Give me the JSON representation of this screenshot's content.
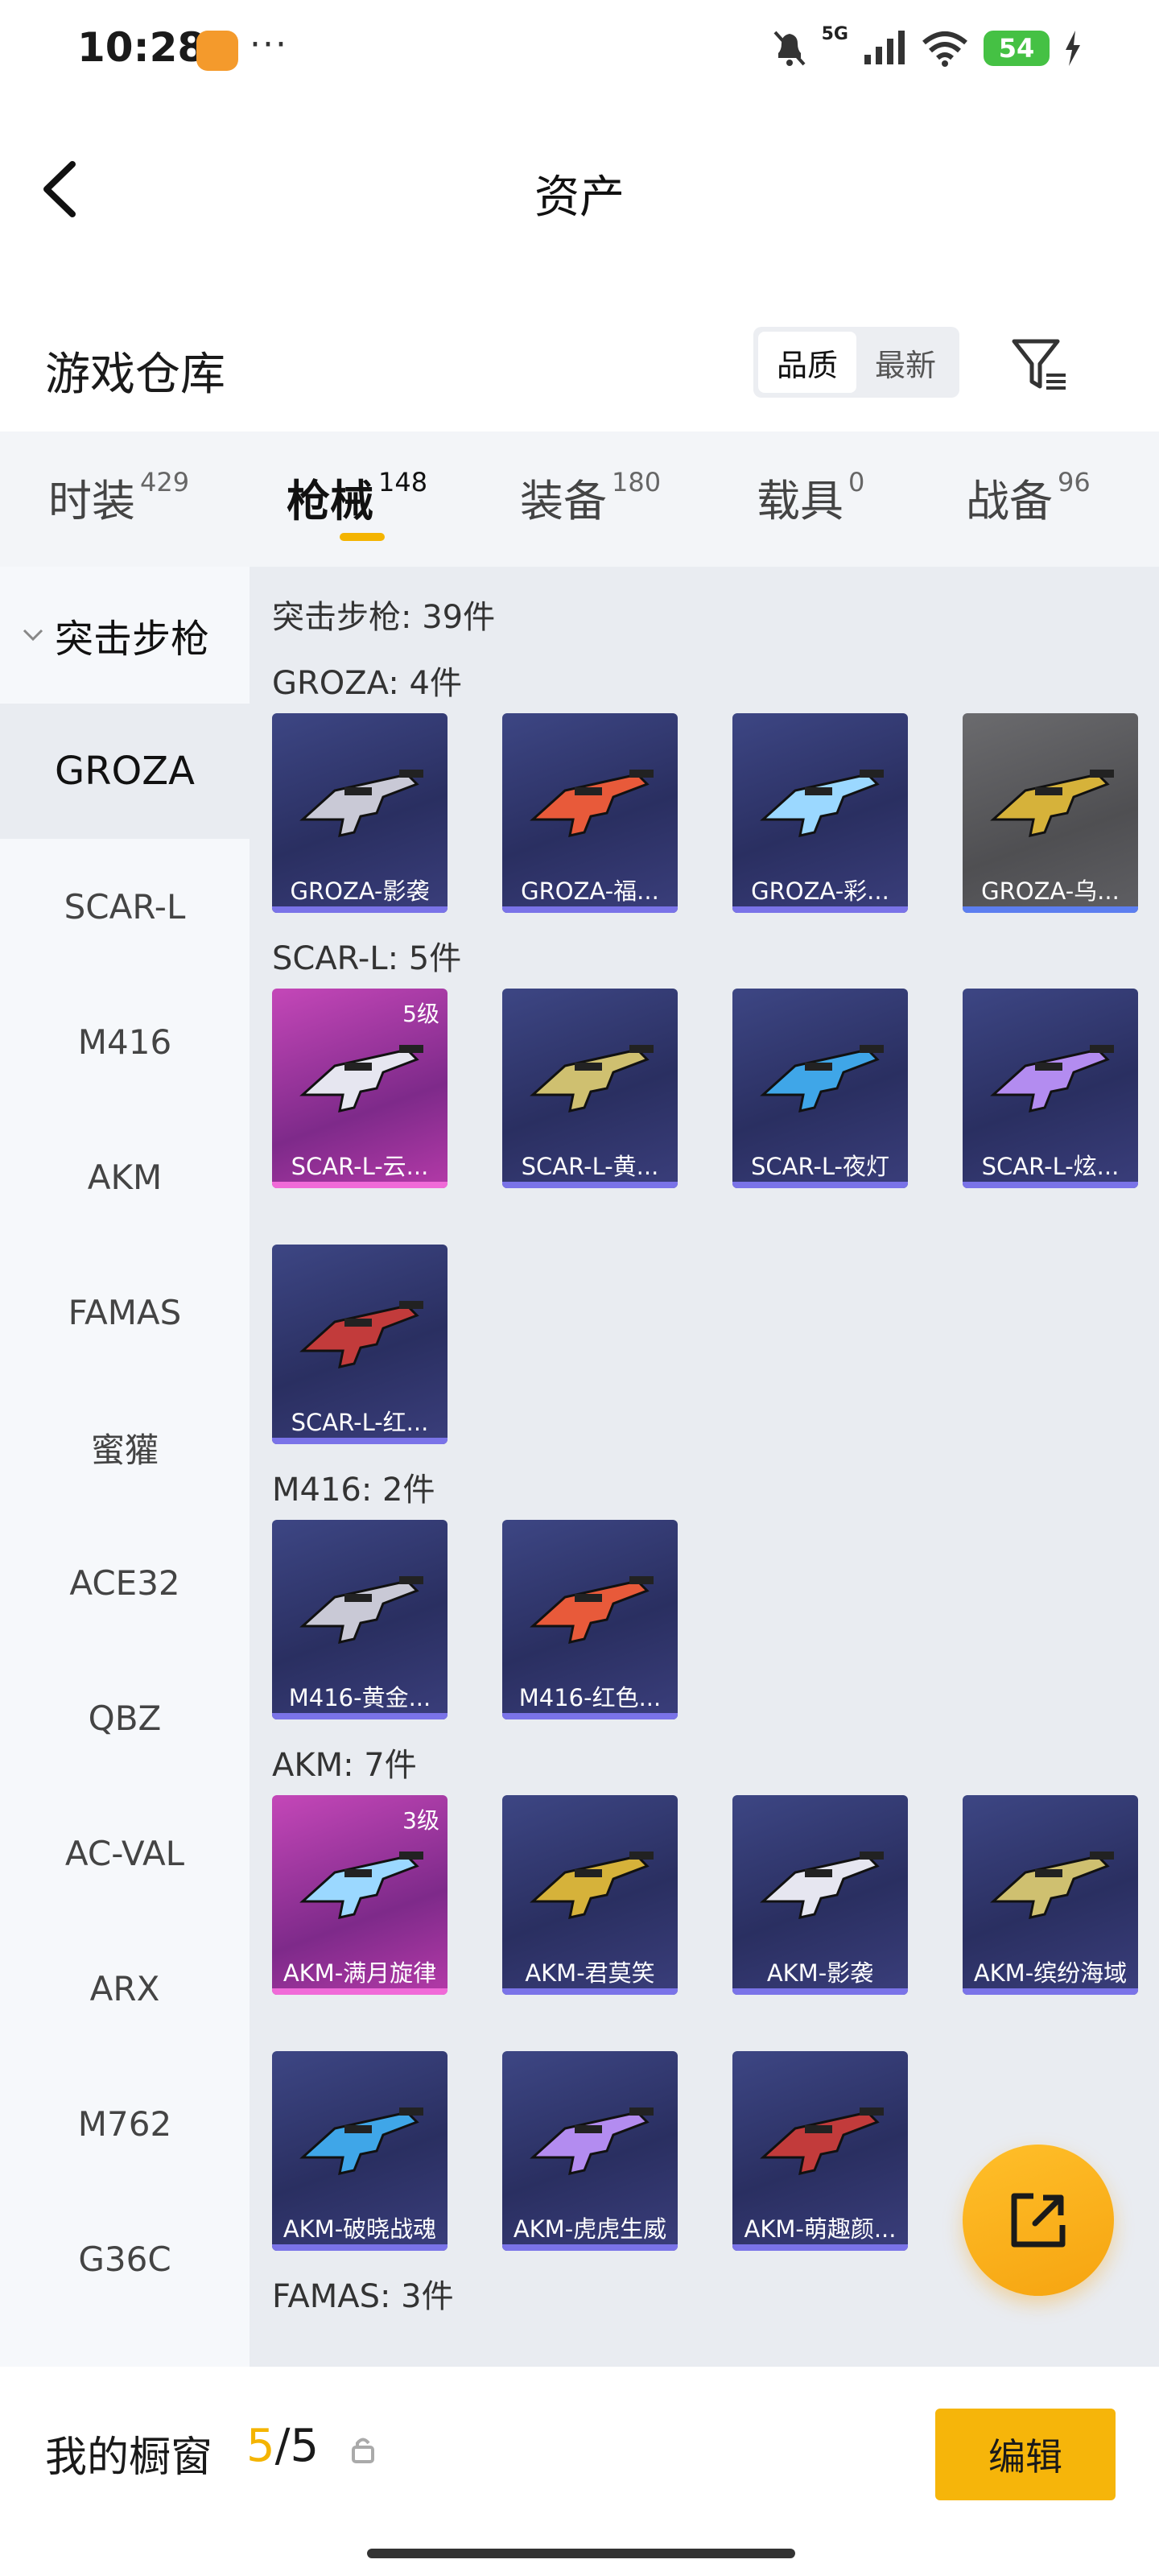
{
  "status_bar": {
    "time": "10:28",
    "more": "···",
    "signal_label": "5G",
    "battery": "54"
  },
  "nav": {
    "title": "资产"
  },
  "header": {
    "title": "游戏仓库",
    "sort_options": [
      "品质",
      "最新"
    ],
    "active_sort": "品质"
  },
  "tabs": [
    {
      "label": "时装",
      "count": "429"
    },
    {
      "label": "枪械",
      "count": "148"
    },
    {
      "label": "装备",
      "count": "180"
    },
    {
      "label": "载具",
      "count": "0"
    },
    {
      "label": "战备",
      "count": "96"
    }
  ],
  "active_tab": "枪械",
  "sidebar": {
    "category": "突击步枪",
    "items": [
      "GROZA",
      "SCAR-L",
      "M416",
      "AKM",
      "FAMAS",
      "蜜獾",
      "ACE32",
      "QBZ",
      "AC-VAL",
      "ARX",
      "M762",
      "G36C"
    ],
    "active_item": "GROZA"
  },
  "main": {
    "summary": "突击步枪: 39件",
    "groups": [
      {
        "title": "GROZA: 4件",
        "items": [
          {
            "name": "GROZA-影袭",
            "tier": "purple",
            "level": ""
          },
          {
            "name": "GROZA-福...",
            "tier": "purple",
            "level": ""
          },
          {
            "name": "GROZA-彩...",
            "tier": "purple",
            "level": ""
          },
          {
            "name": "GROZA-乌...",
            "tier": "gray",
            "level": ""
          }
        ]
      },
      {
        "title": "SCAR-L: 5件",
        "items": [
          {
            "name": "SCAR-L-云...",
            "tier": "pink",
            "level": "5级"
          },
          {
            "name": "SCAR-L-黄...",
            "tier": "purple",
            "level": ""
          },
          {
            "name": "SCAR-L-夜灯",
            "tier": "purple",
            "level": ""
          },
          {
            "name": "SCAR-L-炫...",
            "tier": "purple",
            "level": ""
          },
          {
            "name": "SCAR-L-红...",
            "tier": "purple",
            "level": ""
          }
        ]
      },
      {
        "title": "M416: 2件",
        "items": [
          {
            "name": "M416-黄金...",
            "tier": "purple",
            "level": ""
          },
          {
            "name": "M416-红色...",
            "tier": "purple",
            "level": ""
          }
        ]
      },
      {
        "title": "AKM: 7件",
        "items": [
          {
            "name": "AKM-满月旋律",
            "tier": "pink",
            "level": "3级"
          },
          {
            "name": "AKM-君莫笑",
            "tier": "purple",
            "level": ""
          },
          {
            "name": "AKM-影袭",
            "tier": "purple",
            "level": ""
          },
          {
            "name": "AKM-缤纷海域",
            "tier": "purple",
            "level": ""
          },
          {
            "name": "AKM-破晓战魂",
            "tier": "purple",
            "level": ""
          },
          {
            "name": "AKM-虎虎生威",
            "tier": "purple",
            "level": ""
          },
          {
            "name": "AKM-萌趣颜...",
            "tier": "purple",
            "level": ""
          }
        ]
      },
      {
        "title": "FAMAS: 3件",
        "items": []
      }
    ]
  },
  "bottom": {
    "showcase_label": "我的橱窗",
    "showcase_current": "5",
    "showcase_total": "/5",
    "edit_label": "编辑"
  },
  "colors": {
    "accent": "#f4b400",
    "card_purple": "#2f3566",
    "card_pink": "#b43aa8",
    "card_gray": "#5a5a5d"
  }
}
